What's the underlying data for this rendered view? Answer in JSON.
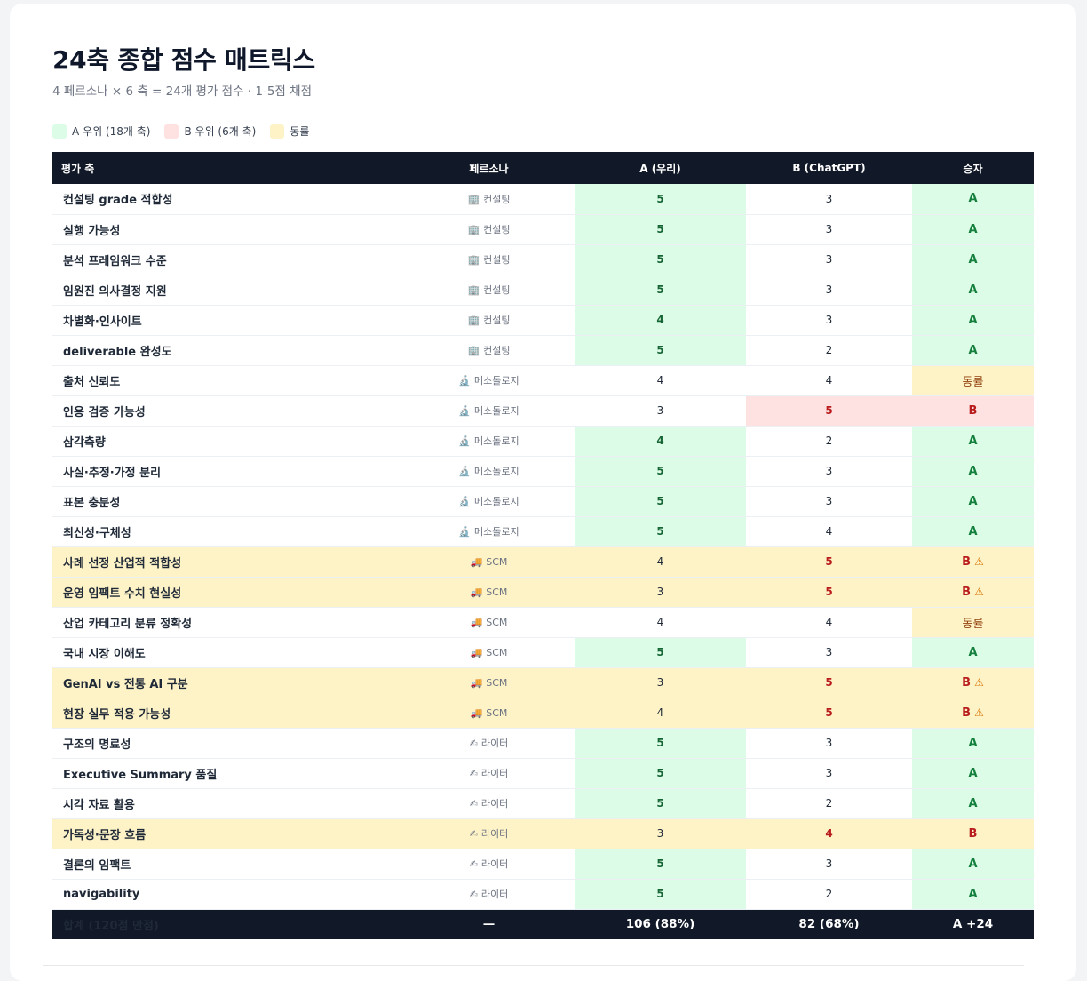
{
  "title": "24축 종합 점수 매트릭스",
  "subtitle": "4 페르소나 × 6 축 = 24개 평가 점수 · 1-5점 채점",
  "legend": [
    {
      "label": "A 우위 (18개 축)",
      "color": "#dcfce7"
    },
    {
      "label": "B 우위 (6개 축)",
      "color": "#fee2e2"
    },
    {
      "label": "동률",
      "color": "#fef3c7"
    }
  ],
  "headers": {
    "axis": "평가 축",
    "persona": "페르소나",
    "a": "A (우리)",
    "b": "B (ChatGPT)",
    "winner": "승자"
  },
  "personas": {
    "consulting": {
      "icon": "building-icon",
      "label": "컨설팅"
    },
    "methodology": {
      "icon": "microscope-icon",
      "label": "메소돌로지"
    },
    "scm": {
      "icon": "truck-icon",
      "label": "SCM"
    },
    "writer": {
      "icon": "writing-hand-icon",
      "label": "라이터"
    }
  },
  "rows": [
    {
      "axis": "컨설팅 grade 적합성",
      "persona": "컨설팅",
      "a": "5",
      "b": "3",
      "winner": "A",
      "result": "a"
    },
    {
      "axis": "실행 가능성",
      "persona": "컨설팅",
      "a": "5",
      "b": "3",
      "winner": "A",
      "result": "a"
    },
    {
      "axis": "분석 프레임워크 수준",
      "persona": "컨설팅",
      "a": "5",
      "b": "3",
      "winner": "A",
      "result": "a"
    },
    {
      "axis": "임원진 의사결정 지원",
      "persona": "컨설팅",
      "a": "5",
      "b": "3",
      "winner": "A",
      "result": "a"
    },
    {
      "axis": "차별화·인사이트",
      "persona": "컨설팅",
      "a": "4",
      "b": "3",
      "winner": "A",
      "result": "a"
    },
    {
      "axis": "deliverable 완성도",
      "persona": "컨설팅",
      "a": "5",
      "b": "2",
      "winner": "A",
      "result": "a"
    },
    {
      "axis": "출처 신뢰도",
      "persona": "메소돌로지",
      "a": "4",
      "b": "4",
      "winner": "동률",
      "result": "tie"
    },
    {
      "axis": "인용 검증 가능성",
      "persona": "메소돌로지",
      "a": "3",
      "b": "5",
      "winner": "B",
      "result": "b"
    },
    {
      "axis": "삼각측량",
      "persona": "메소돌로지",
      "a": "4",
      "b": "2",
      "winner": "A",
      "result": "a"
    },
    {
      "axis": "사실·추정·가정 분리",
      "persona": "메소돌로지",
      "a": "5",
      "b": "3",
      "winner": "A",
      "result": "a"
    },
    {
      "axis": "표본 충분성",
      "persona": "메소돌로지",
      "a": "5",
      "b": "3",
      "winner": "A",
      "result": "a"
    },
    {
      "axis": "최신성·구체성",
      "persona": "메소돌로지",
      "a": "5",
      "b": "4",
      "winner": "A",
      "result": "a"
    },
    {
      "axis": "사례 선정 산업적 적합성",
      "persona": "SCM",
      "a": "4",
      "b": "5",
      "winner": "B",
      "result": "b-flag"
    },
    {
      "axis": "운영 임팩트 수치 현실성",
      "persona": "SCM",
      "a": "3",
      "b": "5",
      "winner": "B",
      "result": "b-flag"
    },
    {
      "axis": "산업 카테고리 분류 정확성",
      "persona": "SCM",
      "a": "4",
      "b": "4",
      "winner": "동률",
      "result": "tie"
    },
    {
      "axis": "국내 시장 이해도",
      "persona": "SCM",
      "a": "5",
      "b": "3",
      "winner": "A",
      "result": "a"
    },
    {
      "axis": "GenAI vs 전통 AI 구분",
      "persona": "SCM",
      "a": "3",
      "b": "5",
      "winner": "B",
      "result": "b-flag"
    },
    {
      "axis": "현장 실무 적용 가능성",
      "persona": "SCM",
      "a": "4",
      "b": "5",
      "winner": "B",
      "result": "b-flag"
    },
    {
      "axis": "구조의 명료성",
      "persona": "라이터",
      "a": "5",
      "b": "3",
      "winner": "A",
      "result": "a"
    },
    {
      "axis": "Executive Summary 품질",
      "persona": "라이터",
      "a": "5",
      "b": "3",
      "winner": "A",
      "result": "a"
    },
    {
      "axis": "시각 자료 활용",
      "persona": "라이터",
      "a": "5",
      "b": "2",
      "winner": "A",
      "result": "a"
    },
    {
      "axis": "가독성·문장 흐름",
      "persona": "라이터",
      "a": "3",
      "b": "4",
      "winner": "B",
      "result": "b-row"
    },
    {
      "axis": "결론의 임팩트",
      "persona": "라이터",
      "a": "5",
      "b": "3",
      "winner": "A",
      "result": "a"
    },
    {
      "axis": "navigability",
      "persona": "라이터",
      "a": "5",
      "b": "2",
      "winner": "A",
      "result": "a"
    }
  ],
  "footer": {
    "axis": "합계 (120점 만점)",
    "persona": "—",
    "a": "106 (88%)",
    "b": "82 (68%)",
    "winner": "A +24"
  }
}
